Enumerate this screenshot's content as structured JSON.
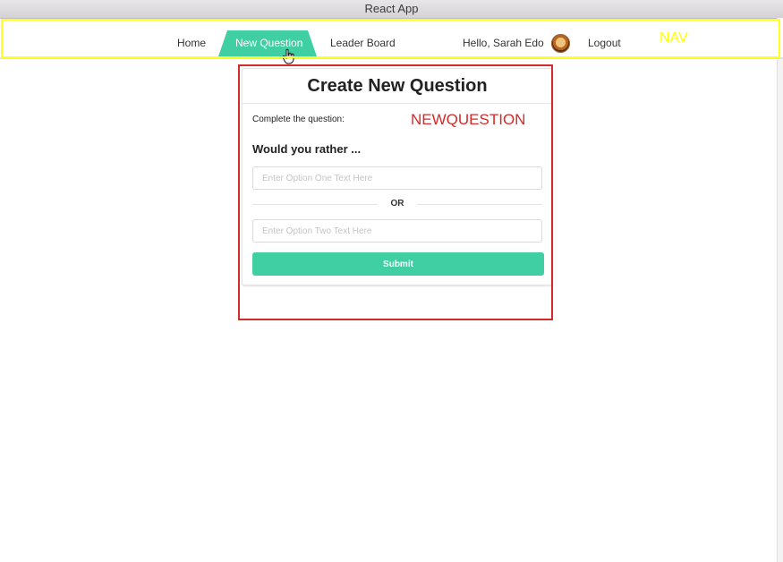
{
  "window": {
    "title": "React App"
  },
  "nav": {
    "items": {
      "home": "Home",
      "new_question": "New Question",
      "leader_board": "Leader Board",
      "greeting": "Hello, Sarah Edo",
      "logout": "Logout"
    },
    "active_item": "New Question",
    "accent_color": "#40cfa2",
    "annotation_label": "NAV",
    "annotation_color": "#ffff00"
  },
  "new_question": {
    "title": "Create New Question",
    "instruction": "Complete the question:",
    "prompt": "Would you rather ...",
    "option_one": {
      "value": "",
      "placeholder": "Enter Option One Text Here"
    },
    "separator": "OR",
    "option_two": {
      "value": "",
      "placeholder": "Enter Option Two Text Here"
    },
    "submit_label": "Submit",
    "annotation_label": "NEWQUESTION",
    "annotation_color": "#d42a2a"
  }
}
